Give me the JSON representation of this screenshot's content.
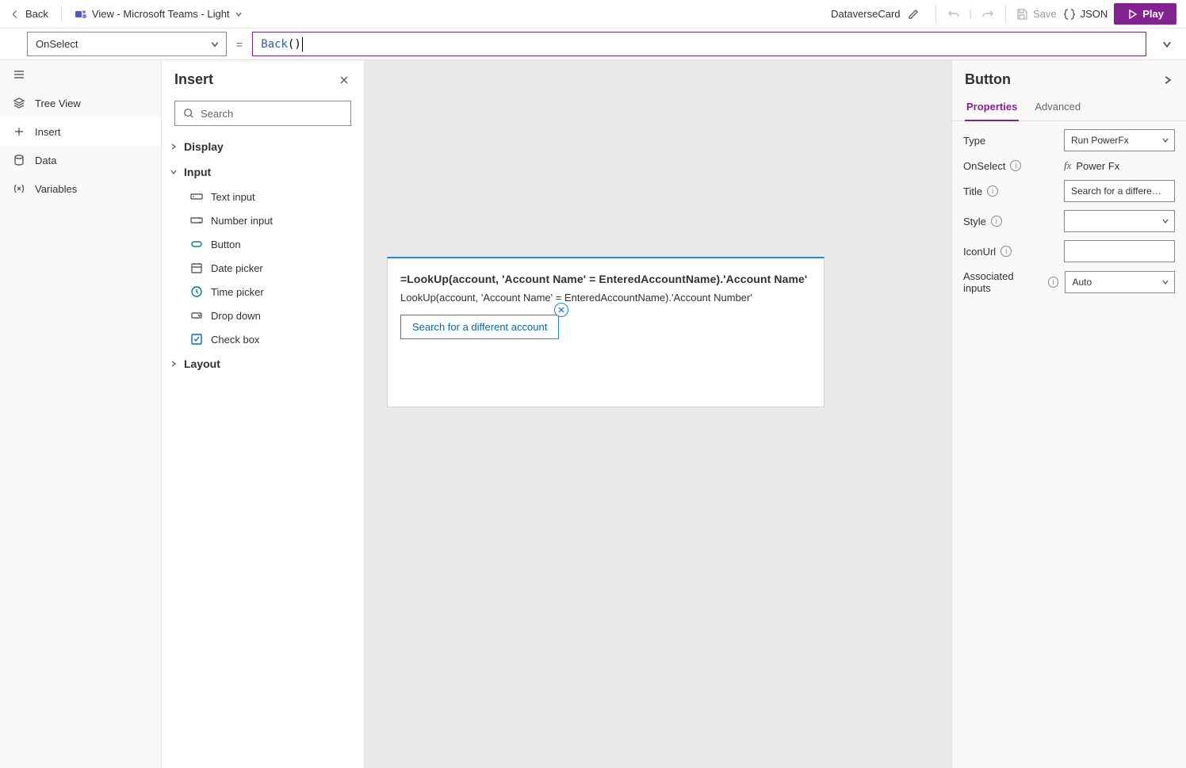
{
  "topbar": {
    "back_label": "Back",
    "view_label": "View - Microsoft Teams - Light",
    "card_name": "DataverseCard",
    "save_label": "Save",
    "json_label": "JSON",
    "play_label": "Play"
  },
  "formula_bar": {
    "property": "OnSelect",
    "expr_fn": "Back",
    "expr_args": "()"
  },
  "leftrail": {
    "items": [
      {
        "label": "Tree View"
      },
      {
        "label": "Insert"
      },
      {
        "label": "Data"
      },
      {
        "label": "Variables"
      }
    ]
  },
  "insert_panel": {
    "title": "Insert",
    "search_placeholder": "Search",
    "categories": {
      "display_label": "Display",
      "input_label": "Input",
      "layout_label": "Layout"
    },
    "input_items": [
      {
        "label": "Text input"
      },
      {
        "label": "Number input"
      },
      {
        "label": "Button"
      },
      {
        "label": "Date picker"
      },
      {
        "label": "Time picker"
      },
      {
        "label": "Drop down"
      },
      {
        "label": "Check box"
      }
    ]
  },
  "card_preview": {
    "title": "=LookUp(account, 'Account Name' = EnteredAccountName).'Account Name'",
    "subtitle": "LookUp(account, 'Account Name' = EnteredAccountName).'Account Number'",
    "button_label": "Search for a different account"
  },
  "props_panel": {
    "header": "Button",
    "tabs": {
      "properties": "Properties",
      "advanced": "Advanced"
    },
    "rows": {
      "type_label": "Type",
      "type_value": "Run PowerFx",
      "onselect_label": "OnSelect",
      "onselect_value": "Power Fx",
      "title_label": "Title",
      "title_value": "Search for a differe…",
      "style_label": "Style",
      "style_value": "",
      "iconurl_label": "IconUrl",
      "iconurl_value": "",
      "assoc_label": "Associated inputs",
      "assoc_value": "Auto"
    }
  }
}
